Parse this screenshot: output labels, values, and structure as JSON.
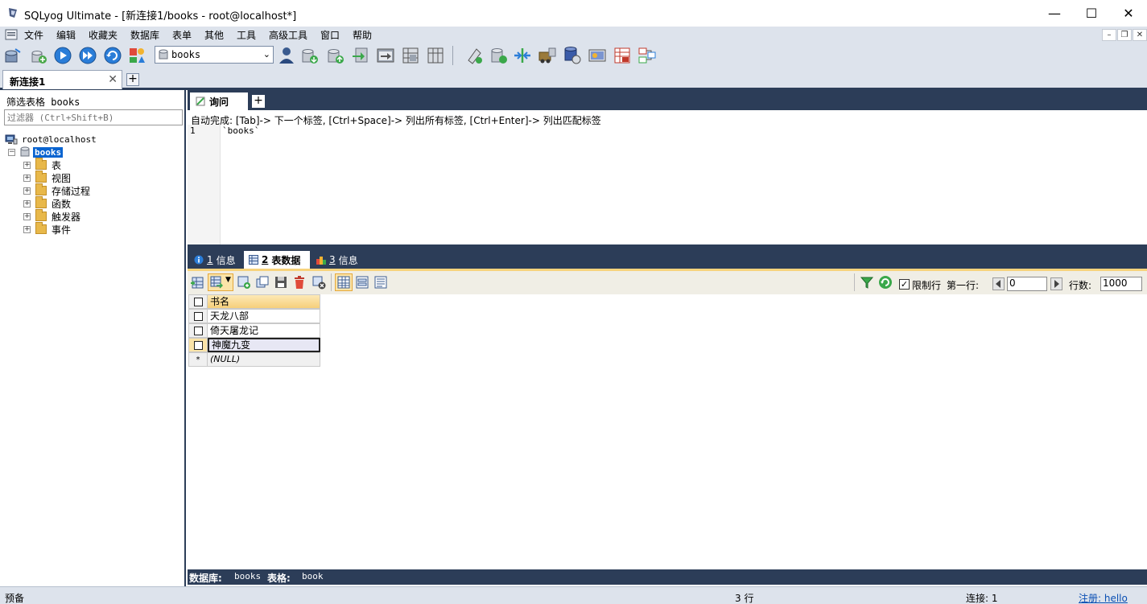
{
  "window": {
    "title": "SQLyog Ultimate - [新连接1/books - root@localhost*]",
    "minimize": "—",
    "maximize": "☐",
    "close": "✕"
  },
  "menu": {
    "items": [
      "文件",
      "编辑",
      "收藏夹",
      "数据库",
      "表单",
      "其他",
      "工具",
      "高级工具",
      "窗口",
      "帮助"
    ],
    "mdi_min": "–",
    "mdi_restore": "❐",
    "mdi_close": "✕"
  },
  "toolbar": {
    "database_select": "books",
    "icons": [
      "connect-icon",
      "new-connection-icon",
      "execute-query-icon",
      "execute-all-icon",
      "refresh-icon",
      "schema-icon",
      "database-select-icon",
      "user-manager-icon",
      "backup-icon",
      "restore-icon",
      "import-icon",
      "copy-db-icon",
      "schema-sync-icon",
      "data-sync-icon",
      "query-builder-icon",
      "schema-designer-icon",
      "sql-editor-icon",
      "data-compare-icon",
      "scheduled-job-icon",
      "notification-icon",
      "report-icon",
      "migration-icon",
      "structure-icon"
    ]
  },
  "connection_tab": {
    "label": "新连接1",
    "close": "✕",
    "add": "+"
  },
  "left_panel": {
    "filter_label": "筛选表格 books",
    "filter_placeholder": "过滤器 (Ctrl+Shift+B)",
    "host": "root@localhost",
    "database": "books",
    "folders": [
      "表",
      "视图",
      "存储过程",
      "函数",
      "触发器",
      "事件"
    ]
  },
  "query": {
    "tab_label": "询问",
    "add": "+",
    "autocomplete_hint": "自动完成: [Tab]-> 下一个标签, [Ctrl+Space]-> 列出所有标签, [Ctrl+Enter]-> 列出匹配标签",
    "line_number": "1",
    "sql": "`books`"
  },
  "result_tabs": [
    {
      "num": "1",
      "label": "信息",
      "active": false
    },
    {
      "num": "2",
      "label": "表数据",
      "active": true
    },
    {
      "num": "3",
      "label": "信息",
      "active": false
    }
  ],
  "result_toolbar": {
    "limit_checked": "✓",
    "limit_label": "限制行",
    "first_row_label": "第一行:",
    "first_row_value": "0",
    "rows_label": "行数:",
    "rows_value": "1000"
  },
  "grid": {
    "column": "书名",
    "rows": [
      "天龙八部",
      "倚天屠龙记",
      "神魔九变"
    ],
    "new_row_marker": "*",
    "null_text": "(NULL)"
  },
  "info_bar": {
    "db_label": "数据库:",
    "db_value": "books",
    "table_label": "表格:",
    "table_value": "book"
  },
  "status_bar": {
    "left": "预备",
    "rows": "3 行",
    "connections": "连接: 1",
    "registered": "注册: hello"
  }
}
